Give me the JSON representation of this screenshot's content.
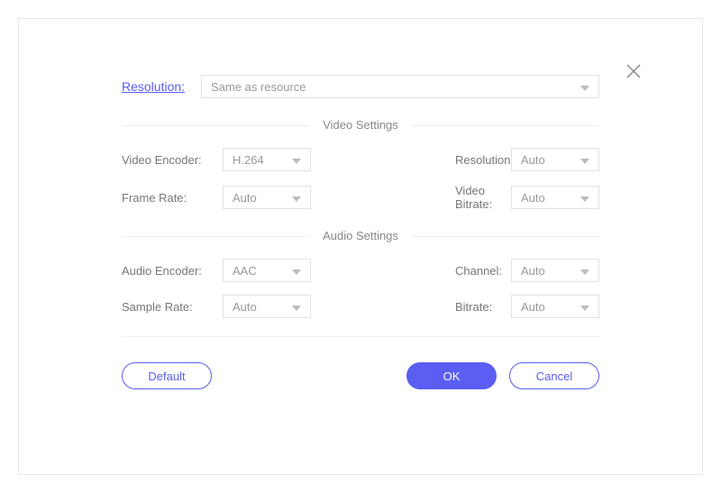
{
  "top": {
    "resolution_label": "Resolution:",
    "resolution_value": "Same as resource"
  },
  "sections": {
    "video_title": "Video Settings",
    "audio_title": "Audio Settings"
  },
  "video": {
    "encoder_label": "Video Encoder:",
    "encoder_value": "H.264",
    "resolution_label": "Resolution:",
    "resolution_value": "Auto",
    "framerate_label": "Frame Rate:",
    "framerate_value": "Auto",
    "bitrate_label": "Video Bitrate:",
    "bitrate_value": "Auto"
  },
  "audio": {
    "encoder_label": "Audio Encoder:",
    "encoder_value": "AAC",
    "channel_label": "Channel:",
    "channel_value": "Auto",
    "samplerate_label": "Sample Rate:",
    "samplerate_value": "Auto",
    "bitrate_label": "Bitrate:",
    "bitrate_value": "Auto"
  },
  "buttons": {
    "default": "Default",
    "ok": "OK",
    "cancel": "Cancel"
  }
}
